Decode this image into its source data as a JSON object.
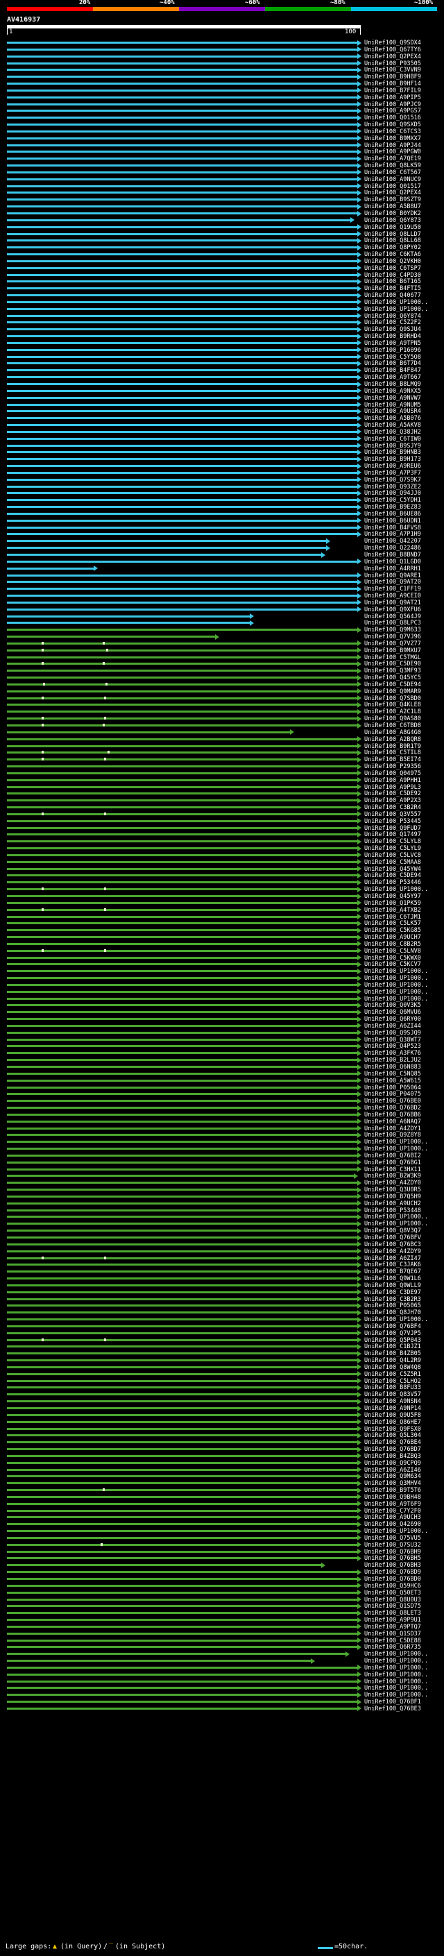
{
  "query": {
    "name": "AV416937",
    "start": "1",
    "end": "100"
  },
  "scale": {
    "labels": [
      "20%",
      "~40%",
      "~60%",
      "~80%",
      "~100%"
    ],
    "colors": [
      "#ff0000",
      "#ff8000",
      "#8000c0",
      "#00a000",
      "#00c0e0"
    ]
  },
  "colors": {
    "high_identity": "#3bc8ea",
    "medium_identity": "#4ca830",
    "dot": "#a0d060",
    "background": "#000000",
    "text": "#ffffff"
  },
  "legend": {
    "prefix": "Large gaps: ",
    "query_gap": "(in Query)",
    "separator": "/",
    "subject_gap": "(in Subject)",
    "scale_text": "=50char."
  },
  "hits": [
    {
      "id": "UniRef100_Q9SDX4",
      "class": "blue"
    },
    {
      "id": "UniRef100_Q67TY6",
      "class": "blue"
    },
    {
      "id": "UniRef100_Q2PEX4",
      "class": "blue"
    },
    {
      "id": "UniRef100_P93505",
      "class": "blue"
    },
    {
      "id": "UniRef100_C3VVN9",
      "class": "blue"
    },
    {
      "id": "UniRef100_B9HBF9",
      "class": "blue"
    },
    {
      "id": "UniRef100_B9HF14",
      "class": "blue"
    },
    {
      "id": "UniRef100_B7FIL9",
      "class": "blue"
    },
    {
      "id": "UniRef100_A9PIP5",
      "class": "blue"
    },
    {
      "id": "UniRef100_A9PJC9",
      "class": "blue"
    },
    {
      "id": "UniRef100_A9PGS7",
      "class": "blue"
    },
    {
      "id": "UniRef100_Q01516",
      "class": "blue"
    },
    {
      "id": "UniRef100_Q9SXD5",
      "class": "blue"
    },
    {
      "id": "UniRef100_C6TCS3",
      "class": "blue"
    },
    {
      "id": "UniRef100_B9MXX7",
      "class": "blue"
    },
    {
      "id": "UniRef100_A9PJ44",
      "class": "blue"
    },
    {
      "id": "UniRef100_A9PGW0",
      "class": "blue"
    },
    {
      "id": "UniRef100_A7QE19",
      "class": "blue"
    },
    {
      "id": "UniRef100_Q8LK59",
      "class": "blue"
    },
    {
      "id": "UniRef100_C6T567",
      "class": "blue"
    },
    {
      "id": "UniRef100_A9NUC9",
      "class": "blue"
    },
    {
      "id": "UniRef100_Q01517",
      "class": "blue"
    },
    {
      "id": "UniRef100_Q2PEX4",
      "class": "blue"
    },
    {
      "id": "UniRef100_B9SZT9",
      "class": "blue"
    },
    {
      "id": "UniRef100_A5B8U7",
      "class": "blue"
    },
    {
      "id": "UniRef100_B0YDK2",
      "class": "blue"
    },
    {
      "id": "UniRef100_Q6Y873",
      "class": "blue"
    },
    {
      "id": "UniRef100_Q19U50",
      "class": "blue"
    },
    {
      "id": "UniRef100_Q8LLD7",
      "class": "blue"
    },
    {
      "id": "UniRef100_Q8LL68",
      "class": "blue"
    },
    {
      "id": "UniRef100_Q8PY02",
      "class": "blue"
    },
    {
      "id": "UniRef100_C6KTA6",
      "class": "blue"
    },
    {
      "id": "UniRef100_Q2VKH0",
      "class": "blue"
    },
    {
      "id": "UniRef100_C6TSP7",
      "class": "blue"
    },
    {
      "id": "UniRef100_C4PD30",
      "class": "blue"
    },
    {
      "id": "UniRef100_B6T165",
      "class": "blue"
    },
    {
      "id": "UniRef100_B4FTI5",
      "class": "blue"
    },
    {
      "id": "UniRef100_Q40677",
      "class": "blue"
    },
    {
      "id": "UniRef100_UP1000..",
      "class": "blue"
    },
    {
      "id": "UniRef100_UP1000..",
      "class": "blue"
    },
    {
      "id": "UniRef100_Q6Y874",
      "class": "blue"
    },
    {
      "id": "UniRef100_C5Z2F2",
      "class": "blue"
    },
    {
      "id": "UniRef100_Q9SJU4",
      "class": "blue"
    },
    {
      "id": "UniRef100_B9RHD4",
      "class": "blue"
    },
    {
      "id": "UniRef100_A9TPN5",
      "class": "blue"
    },
    {
      "id": "UniRef100_P16096",
      "class": "blue"
    },
    {
      "id": "UniRef100_C5Y5O8",
      "class": "blue"
    },
    {
      "id": "UniRef100_B6T7D4",
      "class": "blue"
    },
    {
      "id": "UniRef100_B4F847",
      "class": "blue"
    },
    {
      "id": "UniRef100_A9T667",
      "class": "blue"
    },
    {
      "id": "UniRef100_B8LMQ9",
      "class": "blue"
    },
    {
      "id": "UniRef100_A9NXX5",
      "class": "blue"
    },
    {
      "id": "UniRef100_A9NVW7",
      "class": "blue"
    },
    {
      "id": "UniRef100_A9NUM5",
      "class": "blue"
    },
    {
      "id": "UniRef100_A9USR4",
      "class": "blue"
    },
    {
      "id": "UniRef100_A5B076",
      "class": "blue"
    },
    {
      "id": "UniRef100_A5AKV8",
      "class": "blue"
    },
    {
      "id": "UniRef100_Q38JH2",
      "class": "blue"
    },
    {
      "id": "UniRef100_C6TIW0",
      "class": "blue"
    },
    {
      "id": "UniRef100_B9SJY9",
      "class": "blue"
    },
    {
      "id": "UniRef100_B9HNB3",
      "class": "blue"
    },
    {
      "id": "UniRef100_B9H173",
      "class": "blue"
    },
    {
      "id": "UniRef100_A9REU6",
      "class": "blue"
    },
    {
      "id": "UniRef100_A7P3F7",
      "class": "blue"
    },
    {
      "id": "UniRef100_Q7S9K7",
      "class": "blue"
    },
    {
      "id": "UniRef100_Q93ZE2",
      "class": "blue"
    },
    {
      "id": "UniRef100_Q94JJ0",
      "class": "blue"
    },
    {
      "id": "UniRef100_C5YDH1",
      "class": "blue"
    },
    {
      "id": "UniRef100_B9EZ83",
      "class": "blue"
    },
    {
      "id": "UniRef100_B6UE86",
      "class": "blue"
    },
    {
      "id": "UniRef100_B6UDN1",
      "class": "blue"
    },
    {
      "id": "UniRef100_B4FVS8",
      "class": "blue"
    },
    {
      "id": "UniRef100_A7P1H9",
      "class": "blue"
    },
    {
      "id": "UniRef100_Q42207",
      "class": "blue"
    },
    {
      "id": "UniRef100_Q22486",
      "class": "blue"
    },
    {
      "id": "UniRef100_B8BND7",
      "class": "blue"
    },
    {
      "id": "UniRef100_Q1LGD0",
      "class": "blue"
    },
    {
      "id": "UniRef100_A4RRH1",
      "class": "blue"
    },
    {
      "id": "UniRef100_Q9ARE1",
      "class": "blue"
    },
    {
      "id": "UniRef100_Q9AT20",
      "class": "blue"
    },
    {
      "id": "UniRef100_C1FF19",
      "class": "blue"
    },
    {
      "id": "UniRef100_A9CEI0",
      "class": "blue"
    },
    {
      "id": "UniRef100_Q9AT21",
      "class": "blue"
    },
    {
      "id": "UniRef100_Q9XFU6",
      "class": "blue"
    },
    {
      "id": "UniRef100_Q564J9",
      "class": "blue"
    },
    {
      "id": "UniRef100_Q8LPC3",
      "class": "blue"
    },
    {
      "id": "UniRef100_Q9M633",
      "class": "green"
    },
    {
      "id": "UniRef100_Q7VJ96",
      "class": "green"
    },
    {
      "id": "UniRef100_Q7VZ77",
      "class": "green"
    },
    {
      "id": "UniRef100_B9MXU7",
      "class": "green"
    },
    {
      "id": "UniRef100_C5TMGL",
      "class": "green"
    },
    {
      "id": "UniRef100_C5DE90",
      "class": "green"
    },
    {
      "id": "UniRef100_Q3MF93",
      "class": "green"
    },
    {
      "id": "UniRef100_Q45YC5",
      "class": "green"
    },
    {
      "id": "UniRef100_C5DE94",
      "class": "green"
    },
    {
      "id": "UniRef100_Q9MAR9",
      "class": "green"
    },
    {
      "id": "UniRef100_Q7SBD0",
      "class": "green"
    },
    {
      "id": "UniRef100_Q4KLE8",
      "class": "green"
    },
    {
      "id": "UniRef100_A2C1L8",
      "class": "green"
    },
    {
      "id": "UniRef100_Q9AS80",
      "class": "green"
    },
    {
      "id": "UniRef100_C6TBD8",
      "class": "green"
    },
    {
      "id": "UniRef100_A8G4G0",
      "class": "green"
    },
    {
      "id": "UniRef100_A2BQR8",
      "class": "green"
    },
    {
      "id": "UniRef100_B9R1T9",
      "class": "green"
    },
    {
      "id": "UniRef100_C5TIL8",
      "class": "green"
    },
    {
      "id": "UniRef100_B5EI74",
      "class": "green"
    },
    {
      "id": "UniRef100_P29356",
      "class": "green"
    },
    {
      "id": "UniRef100_Q04975",
      "class": "green"
    },
    {
      "id": "UniRef100_A9PHH1",
      "class": "green"
    },
    {
      "id": "UniRef100_A9P9L3",
      "class": "green"
    },
    {
      "id": "UniRef100_C5DE92",
      "class": "green"
    },
    {
      "id": "UniRef100_A9P2X3",
      "class": "green"
    },
    {
      "id": "UniRef100_C3B2R4",
      "class": "green"
    },
    {
      "id": "UniRef100_Q3V557",
      "class": "green"
    },
    {
      "id": "UniRef100_P53445",
      "class": "green"
    },
    {
      "id": "UniRef100_Q9FUD7",
      "class": "green"
    },
    {
      "id": "UniRef100_Q17497",
      "class": "green"
    },
    {
      "id": "UniRef100_C5LYL8",
      "class": "green"
    },
    {
      "id": "UniRef100_C5LYL9",
      "class": "green"
    },
    {
      "id": "UniRef100_C5LVC8",
      "class": "green"
    },
    {
      "id": "UniRef100_C5MAA8",
      "class": "green"
    },
    {
      "id": "UniRef100_Q45YW4",
      "class": "green"
    },
    {
      "id": "UniRef100_C5DE94",
      "class": "green"
    },
    {
      "id": "UniRef100_P53446",
      "class": "green"
    },
    {
      "id": "UniRef100_UP1000..",
      "class": "green"
    },
    {
      "id": "UniRef100_Q45Y97",
      "class": "green"
    },
    {
      "id": "UniRef100_Q1PK59",
      "class": "green"
    },
    {
      "id": "UniRef100_A4TXB2",
      "class": "green"
    },
    {
      "id": "UniRef100_C6TJM1",
      "class": "green"
    },
    {
      "id": "UniRef100_C5LK57",
      "class": "green"
    },
    {
      "id": "UniRef100_C5KG85",
      "class": "green"
    },
    {
      "id": "UniRef100_A9UCH7",
      "class": "green"
    },
    {
      "id": "UniRef100_C8B2R5",
      "class": "green"
    },
    {
      "id": "UniRef100_C5LNV8",
      "class": "green"
    },
    {
      "id": "UniRef100_C5KWX0",
      "class": "green"
    },
    {
      "id": "UniRef100_C5KCV7",
      "class": "green"
    },
    {
      "id": "UniRef100_UP1000..",
      "class": "green"
    },
    {
      "id": "UniRef100_UP1000..",
      "class": "green"
    },
    {
      "id": "UniRef100_UP1000..",
      "class": "green"
    },
    {
      "id": "UniRef100_UP1000..",
      "class": "green"
    },
    {
      "id": "UniRef100_UP1000..",
      "class": "green"
    },
    {
      "id": "UniRef100_Q0V3K5",
      "class": "green"
    },
    {
      "id": "UniRef100_Q6MVU6",
      "class": "green"
    },
    {
      "id": "UniRef100_Q6RY00",
      "class": "green"
    },
    {
      "id": "UniRef100_A6ZI44",
      "class": "green"
    },
    {
      "id": "UniRef100_Q9SJQ9",
      "class": "green"
    },
    {
      "id": "UniRef100_Q38WT7",
      "class": "green"
    },
    {
      "id": "UniRef100_Q4P523",
      "class": "green"
    },
    {
      "id": "UniRef100_A3FK76",
      "class": "green"
    },
    {
      "id": "UniRef100_B2LJU2",
      "class": "green"
    },
    {
      "id": "UniRef100_Q6N883",
      "class": "green"
    },
    {
      "id": "UniRef100_C5NQ85",
      "class": "green"
    },
    {
      "id": "UniRef100_A5W615",
      "class": "green"
    },
    {
      "id": "UniRef100_P05064",
      "class": "green"
    },
    {
      "id": "UniRef100_P04075",
      "class": "green"
    },
    {
      "id": "UniRef100_Q76BE0",
      "class": "green"
    },
    {
      "id": "UniRef100_Q76BD2",
      "class": "green"
    },
    {
      "id": "UniRef100_Q76BB6",
      "class": "green"
    },
    {
      "id": "UniRef100_A6NAQ7",
      "class": "green"
    },
    {
      "id": "UniRef100_A4ZDY1",
      "class": "green"
    },
    {
      "id": "UniRef100_Q9Z8Y8",
      "class": "green"
    },
    {
      "id": "UniRef100_UP1000..",
      "class": "green"
    },
    {
      "id": "UniRef100_UP1000..",
      "class": "green"
    },
    {
      "id": "UniRef100_Q76BI2",
      "class": "green"
    },
    {
      "id": "UniRef100_Q76BG1",
      "class": "green"
    },
    {
      "id": "UniRef100_C3HX11",
      "class": "green"
    },
    {
      "id": "UniRef100_B2W3K9",
      "class": "green"
    },
    {
      "id": "UniRef100_A4ZDY0",
      "class": "green"
    },
    {
      "id": "UniRef100_Q3U0R5",
      "class": "green"
    },
    {
      "id": "UniRef100_B7Q5H9",
      "class": "green"
    },
    {
      "id": "UniRef100_A9UCH2",
      "class": "green"
    },
    {
      "id": "UniRef100_P53448",
      "class": "green"
    },
    {
      "id": "UniRef100_UP1000..",
      "class": "green"
    },
    {
      "id": "UniRef100_UP1000..",
      "class": "green"
    },
    {
      "id": "UniRef100_Q8V3Q7",
      "class": "green"
    },
    {
      "id": "UniRef100_Q76BFV",
      "class": "green"
    },
    {
      "id": "UniRef100_Q76BC3",
      "class": "green"
    },
    {
      "id": "UniRef100_A4ZDY9",
      "class": "green"
    },
    {
      "id": "UniRef100_A6ZI47",
      "class": "green"
    },
    {
      "id": "UniRef100_C3JAK6",
      "class": "green"
    },
    {
      "id": "UniRef100_B7QE67",
      "class": "green"
    },
    {
      "id": "UniRef100_Q9W1L6",
      "class": "green"
    },
    {
      "id": "UniRef100_Q9WLL9",
      "class": "green"
    },
    {
      "id": "UniRef100_C3DE97",
      "class": "green"
    },
    {
      "id": "UniRef100_C3B2R3",
      "class": "green"
    },
    {
      "id": "UniRef100_P05065",
      "class": "green"
    },
    {
      "id": "UniRef100_Q8JH70",
      "class": "green"
    },
    {
      "id": "UniRef100_UP1000..",
      "class": "green"
    },
    {
      "id": "UniRef100_Q76BF4",
      "class": "green"
    },
    {
      "id": "UniRef100_Q7VJP5",
      "class": "green"
    },
    {
      "id": "UniRef100_Q5P043",
      "class": "green"
    },
    {
      "id": "UniRef100_C1BJZ1",
      "class": "green"
    },
    {
      "id": "UniRef100_B4ZB05",
      "class": "green"
    },
    {
      "id": "UniRef100_Q4L2R9",
      "class": "green"
    },
    {
      "id": "UniRef100_Q8W4Q8",
      "class": "green"
    },
    {
      "id": "UniRef100_C5Z5R1",
      "class": "green"
    },
    {
      "id": "UniRef100_C5LHO2",
      "class": "green"
    },
    {
      "id": "UniRef100_B8FU33",
      "class": "green"
    },
    {
      "id": "UniRef100_Q83V57",
      "class": "green"
    },
    {
      "id": "UniRef100_A9NSN4",
      "class": "green"
    },
    {
      "id": "UniRef100_A9NP14",
      "class": "green"
    },
    {
      "id": "UniRef100_Q9U5F8",
      "class": "green"
    },
    {
      "id": "UniRef100_Q86HE7",
      "class": "green"
    },
    {
      "id": "UniRef100_Q9FSX0",
      "class": "green"
    },
    {
      "id": "UniRef100_Q5L304",
      "class": "green"
    },
    {
      "id": "UniRef100_Q76BE4",
      "class": "green"
    },
    {
      "id": "UniRef100_Q76BD7",
      "class": "green"
    },
    {
      "id": "UniRef100_B4ZBQ3",
      "class": "green"
    },
    {
      "id": "UniRef100_Q9CPQ9",
      "class": "green"
    },
    {
      "id": "UniRef100_A6ZI46",
      "class": "green"
    },
    {
      "id": "UniRef100_Q9M634",
      "class": "green"
    },
    {
      "id": "UniRef100_Q3MHV4",
      "class": "green"
    },
    {
      "id": "UniRef100_B9T5T6",
      "class": "green"
    },
    {
      "id": "UniRef100_Q9BH48",
      "class": "green"
    },
    {
      "id": "UniRef100_A9T6F9",
      "class": "green"
    },
    {
      "id": "UniRef100_C7Y2F0",
      "class": "green"
    },
    {
      "id": "UniRef100_A9UCH3",
      "class": "green"
    },
    {
      "id": "UniRef100_Q42690",
      "class": "green"
    },
    {
      "id": "UniRef100_UP1000..",
      "class": "green"
    },
    {
      "id": "UniRef100_Q75VU5",
      "class": "green"
    },
    {
      "id": "UniRef100_Q7SU32",
      "class": "green"
    },
    {
      "id": "UniRef100_Q76BH9",
      "class": "green"
    },
    {
      "id": "UniRef100_Q76BH5",
      "class": "green"
    },
    {
      "id": "UniRef100_Q76BH3",
      "class": "green"
    },
    {
      "id": "UniRef100_Q76BD9",
      "class": "green"
    },
    {
      "id": "UniRef100_Q76BD0",
      "class": "green"
    },
    {
      "id": "UniRef100_Q59HC6",
      "class": "green"
    },
    {
      "id": "UniRef100_Q50ET3",
      "class": "green"
    },
    {
      "id": "UniRef100_Q8U0U3",
      "class": "green"
    },
    {
      "id": "UniRef100_Q1SD75",
      "class": "green"
    },
    {
      "id": "UniRef100_Q8LET3",
      "class": "green"
    },
    {
      "id": "UniRef100_A9P9U1",
      "class": "green"
    },
    {
      "id": "UniRef100_A9PTQ7",
      "class": "green"
    },
    {
      "id": "UniRef100_Q1SD37",
      "class": "green"
    },
    {
      "id": "UniRef100_C5DE88",
      "class": "green"
    },
    {
      "id": "UniRef100_Q6R735",
      "class": "green"
    },
    {
      "id": "UniRef100_UP1000..",
      "class": "green"
    },
    {
      "id": "UniRef100_UP1000..",
      "class": "green"
    },
    {
      "id": "UniRef100_UP1000..",
      "class": "green"
    },
    {
      "id": "UniRef100_UP1000..",
      "class": "green"
    },
    {
      "id": "UniRef100_UP1000..",
      "class": "green"
    },
    {
      "id": "UniRef100_UP1000..",
      "class": "green"
    },
    {
      "id": "UniRef100_UP1000..",
      "class": "green"
    },
    {
      "id": "UniRef100_Q76BF1",
      "class": "green"
    },
    {
      "id": "UniRef100_Q76BE3",
      "class": "green"
    }
  ]
}
